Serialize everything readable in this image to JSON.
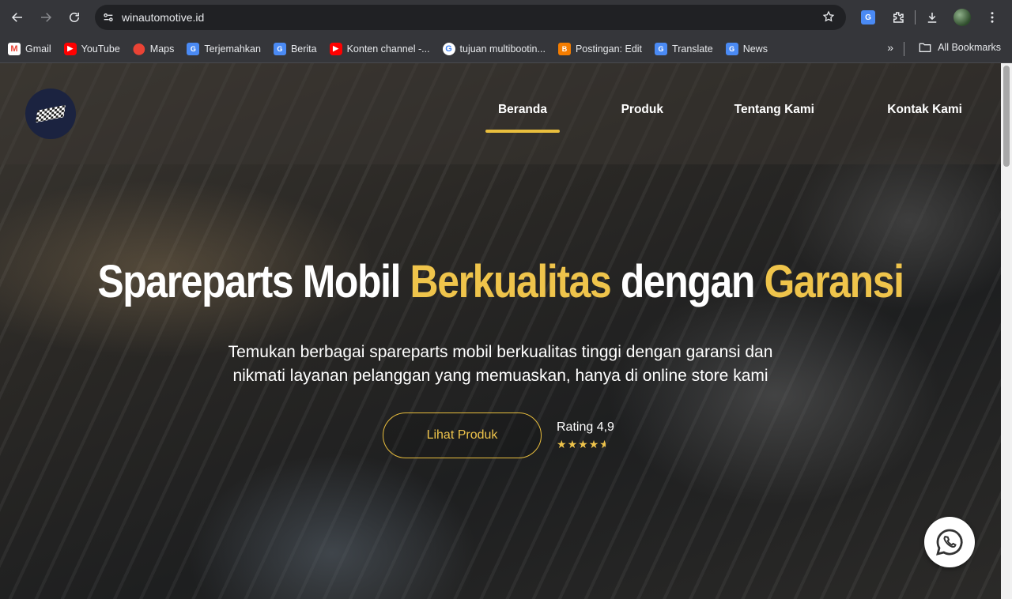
{
  "browser": {
    "url": "winautomotive.id",
    "icons": [
      "back-icon",
      "forward-icon",
      "reload-icon",
      "site-info-icon",
      "bookmark-star-icon",
      "translate-icon",
      "extensions-icon",
      "download-icon",
      "profile-avatar",
      "menu-icon"
    ]
  },
  "bookmarks": {
    "items": [
      {
        "label": "Gmail",
        "icon": "gmail-icon"
      },
      {
        "label": "YouTube",
        "icon": "youtube-icon"
      },
      {
        "label": "Maps",
        "icon": "maps-icon"
      },
      {
        "label": "Terjemahkan",
        "icon": "google-translate-icon"
      },
      {
        "label": "Berita",
        "icon": "google-translate-icon"
      },
      {
        "label": "Konten channel -...",
        "icon": "youtube-icon"
      },
      {
        "label": "tujuan multibootin...",
        "icon": "google-icon"
      },
      {
        "label": "Postingan: Edit",
        "icon": "blogger-icon"
      },
      {
        "label": "Translate",
        "icon": "google-translate-icon"
      },
      {
        "label": "News",
        "icon": "google-translate-icon"
      }
    ],
    "overflow": "»",
    "all_bookmarks": "All Bookmarks"
  },
  "site": {
    "nav": {
      "home": "Beranda",
      "products": "Produk",
      "about": "Tentang Kami",
      "contact": "Kontak Kami"
    },
    "hero": {
      "title_part1": "Spareparts Mobil ",
      "title_hl1": "Berkualitas",
      "title_part2": " dengan ",
      "title_hl2": "Garansi",
      "subtitle_line1": "Temukan berbagai spareparts mobil berkualitas tinggi dengan garansi dan",
      "subtitle_line2": "nikmati layanan pelanggan yang memuaskan, hanya di online store kami",
      "cta": "Lihat Produk",
      "rating_label": "Rating 4,9",
      "rating_value": 4.9
    },
    "colors": {
      "accent": "#efc44b",
      "text": "#ffffff"
    }
  }
}
